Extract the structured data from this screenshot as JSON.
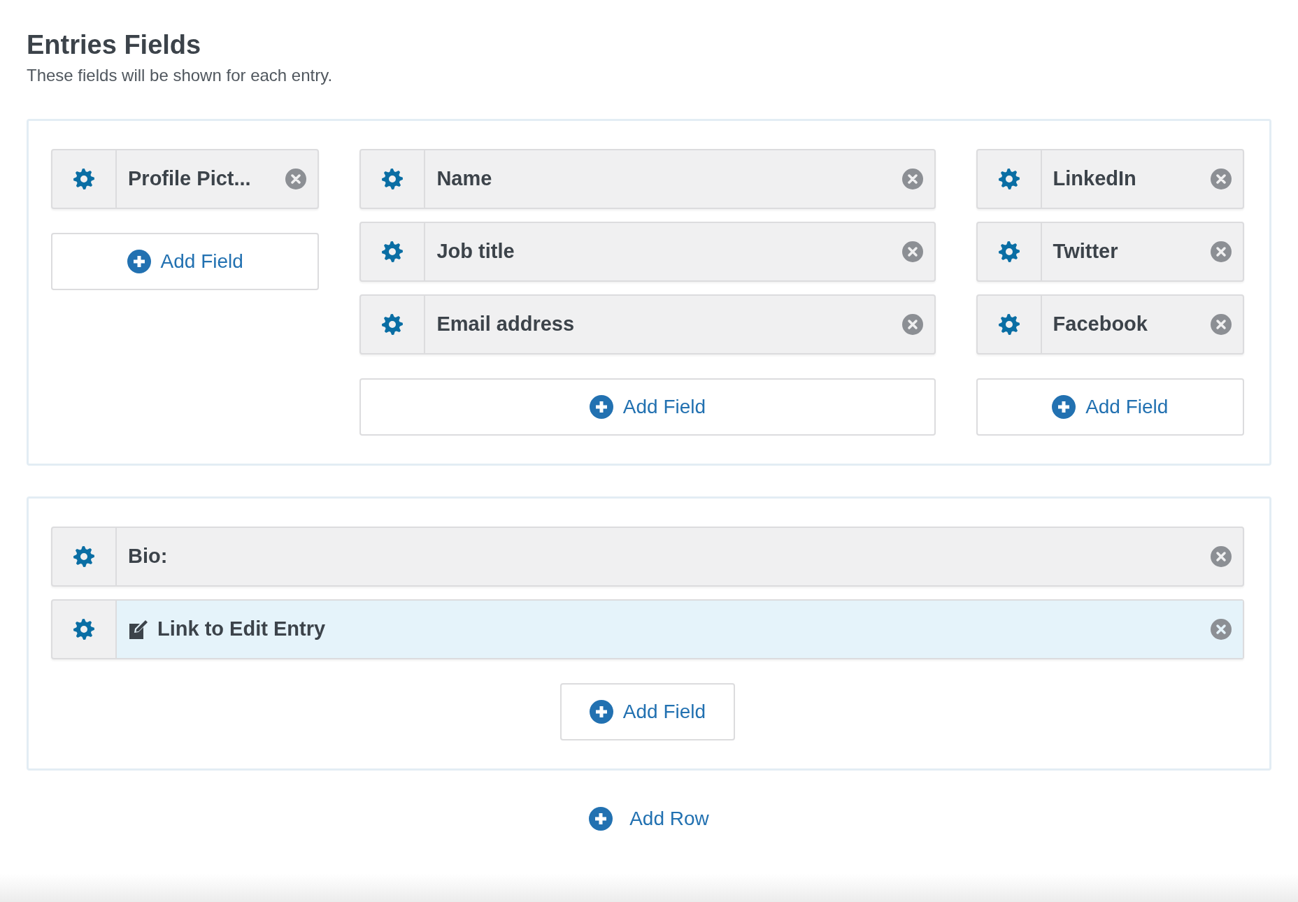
{
  "header": {
    "title": "Entries Fields",
    "subtitle": "These fields will be shown for each entry."
  },
  "rows": [
    {
      "columns": [
        {
          "fields": [
            {
              "label": "Profile Pict...",
              "kind": "field"
            }
          ],
          "add_label": "Add Field"
        },
        {
          "fields": [
            {
              "label": "Name",
              "kind": "field"
            },
            {
              "label": "Job title",
              "kind": "field"
            },
            {
              "label": "Email address",
              "kind": "field"
            }
          ],
          "add_label": "Add Field"
        },
        {
          "fields": [
            {
              "label": "LinkedIn",
              "kind": "field"
            },
            {
              "label": "Twitter",
              "kind": "field"
            },
            {
              "label": "Facebook",
              "kind": "field"
            }
          ],
          "add_label": "Add Field"
        }
      ]
    },
    {
      "columns": [
        {
          "fields": [
            {
              "label": "Bio:",
              "kind": "field"
            },
            {
              "label": "Link to Edit Entry",
              "kind": "edit_link"
            }
          ],
          "add_label": "Add Field"
        }
      ]
    }
  ],
  "add_row": {
    "label": "Add Row"
  }
}
